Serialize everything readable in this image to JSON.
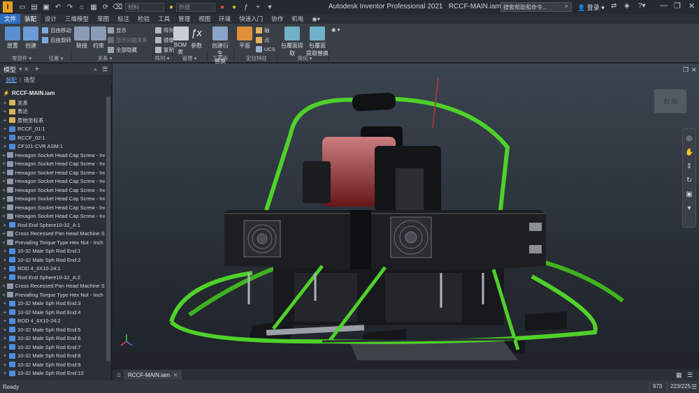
{
  "app": {
    "title": "Autodesk Inventor Professional 2021",
    "document": "RCCF-MAIN.iam",
    "help_search_placeholder": "搜索帮助和命令...",
    "login": "登录"
  },
  "quick_access": {
    "material_placeholder": "材料",
    "appearance_placeholder": "外观"
  },
  "menu_tabs": [
    "文件",
    "装配",
    "设计",
    "三维模型",
    "草图",
    "标注",
    "检验",
    "工具",
    "管理",
    "视图",
    "环境",
    "快速入门",
    "协作",
    "机电"
  ],
  "ribbon": {
    "place": "放置",
    "create": "创建",
    "auto_move": "自由移动",
    "auto_rotate": "自由旋转",
    "join": "联接",
    "constrain": "约束",
    "show": "显示",
    "show_relationships": "显示问题关系",
    "hide_all": "全部隐藏",
    "pattern": "阵列",
    "mirror": "镜像",
    "copy": "复制",
    "bom": "BOM\n表",
    "params": "参数",
    "create_derived": "创建衍生\n替换",
    "plane": "平面",
    "axis": "轴",
    "point": "点",
    "ucs": "UCS",
    "shrinkwrap": "包覆面提取",
    "shrinkwrap_sub": "包覆面\n提取替换",
    "panels": [
      "零部件",
      "位置",
      "关系",
      "阵列",
      "管理",
      "工具库",
      "定位特征",
      "简化"
    ]
  },
  "browser": {
    "tab_model": "模型",
    "sub_assembly": "装配",
    "sub_modeling": "造型",
    "root": "RCCF-MAIN.iam",
    "items": [
      {
        "label": "关系",
        "icon": "fold"
      },
      {
        "label": "表达",
        "icon": "fold"
      },
      {
        "label": "原始坐标系",
        "icon": "fold"
      },
      {
        "label": "RCCF_01:1",
        "icon": "asm"
      },
      {
        "label": "RCCF_02:1",
        "icon": "asm"
      },
      {
        "label": "CF101-CVR ASM:1",
        "icon": "asm"
      },
      {
        "label": "Hexagon Socket Head Cap Screw - Inch",
        "icon": "cc"
      },
      {
        "label": "Hexagon Socket Head Cap Screw - Inch",
        "icon": "cc"
      },
      {
        "label": "Hexagon Socket Head Cap Screw - Inch",
        "icon": "cc"
      },
      {
        "label": "Hexagon Socket Head Cap Screw - Inch",
        "icon": "cc"
      },
      {
        "label": "Hexagon Socket Head Cap Screw - Inch",
        "icon": "cc"
      },
      {
        "label": "Hexagon Socket Head Cap Screw - Inch",
        "icon": "cc"
      },
      {
        "label": "Hexagon Socket Head Cap Screw - Inch",
        "icon": "cc"
      },
      {
        "label": "Hexagon Socket Head Cap Screw - Inch",
        "icon": "cc"
      },
      {
        "label": "Rod End Sphere10-32_A:1",
        "icon": "part"
      },
      {
        "label": "Cross Recessed Pan Head Machine Screw",
        "icon": "cc"
      },
      {
        "label": "Prevailing Torque Type Hex Nut - Inch (E",
        "icon": "cc"
      },
      {
        "label": "10-32 Male Sph Rod End:1",
        "icon": "part"
      },
      {
        "label": "10-32 Male Sph Rod End:2",
        "icon": "part"
      },
      {
        "label": "ROD 4_6X10-24:1",
        "icon": "part"
      },
      {
        "label": "Rod End Sphere10-32_A:2",
        "icon": "part"
      },
      {
        "label": "Cross Recessed Pan Head Machine Screw",
        "icon": "cc"
      },
      {
        "label": "Prevailing Torque Type Hex Nut - Inch (E",
        "icon": "cc"
      },
      {
        "label": "10-32 Male Sph Rod End:3",
        "icon": "part"
      },
      {
        "label": "10-32 Male Sph Rod End:4",
        "icon": "part"
      },
      {
        "label": "ROD 4_6X10-24:2",
        "icon": "part"
      },
      {
        "label": "10-32 Male Sph Rod End:5",
        "icon": "part"
      },
      {
        "label": "10-32 Male Sph Rod End:6",
        "icon": "part"
      },
      {
        "label": "10-32 Male Sph Rod End:7",
        "icon": "part"
      },
      {
        "label": "10-32 Male Sph Rod End:8",
        "icon": "part"
      },
      {
        "label": "10-32 Male Sph Rod End:9",
        "icon": "part"
      },
      {
        "label": "10-32 Male Sph Rod End:10",
        "icon": "part"
      }
    ]
  },
  "doc_tab": "RCCF-MAIN.iam",
  "viewcube_label": "右 后",
  "status": {
    "text": "Ready",
    "count1": "973",
    "count2": "223/225"
  },
  "colors": {
    "accent": "#2f6fc0",
    "frame_green": "#4fd12a",
    "body": "#1c1e21",
    "engine_red": "#a8262b"
  }
}
